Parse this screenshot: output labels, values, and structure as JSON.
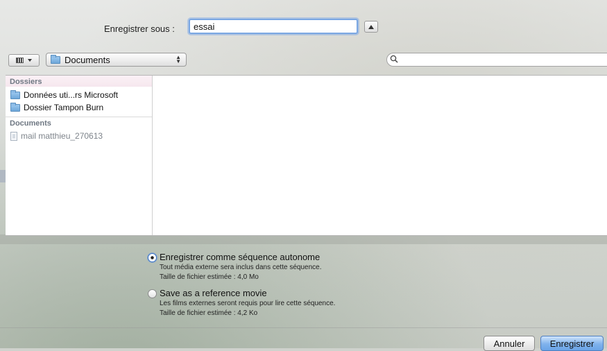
{
  "save_as": {
    "label": "Enregistrer sous :",
    "filename": "essai"
  },
  "toolbar": {
    "view_icon": "icon-view-grid",
    "location": "Documents",
    "search_value": ""
  },
  "sidebar": {
    "sections": [
      {
        "title": "Dossiers",
        "items": [
          {
            "label": "Données uti...rs Microsoft",
            "icon": "folder-icon"
          },
          {
            "label": "Dossier Tampon Burn",
            "icon": "folder-icon"
          }
        ]
      },
      {
        "title": "Documents",
        "items": [
          {
            "label": "mail matthieu_270613",
            "icon": "document-icon"
          }
        ]
      }
    ]
  },
  "options": [
    {
      "title": "Enregistrer comme séquence autonome",
      "selected": true,
      "desc": "Tout média externe sera inclus dans cette séquence.",
      "size": "Taille de fichier estimée : 4,0 Mo"
    },
    {
      "title": "Save as a reference movie",
      "selected": false,
      "desc": "Les films externes seront requis pour lire cette séquence.",
      "size": "Taille de fichier estimée : 4,2 Ko"
    }
  ],
  "buttons": {
    "cancel": "Annuler",
    "save": "Enregistrer"
  },
  "colors": {
    "accent": "#6aa4e7",
    "focus_ring": "#7aa7e3"
  }
}
